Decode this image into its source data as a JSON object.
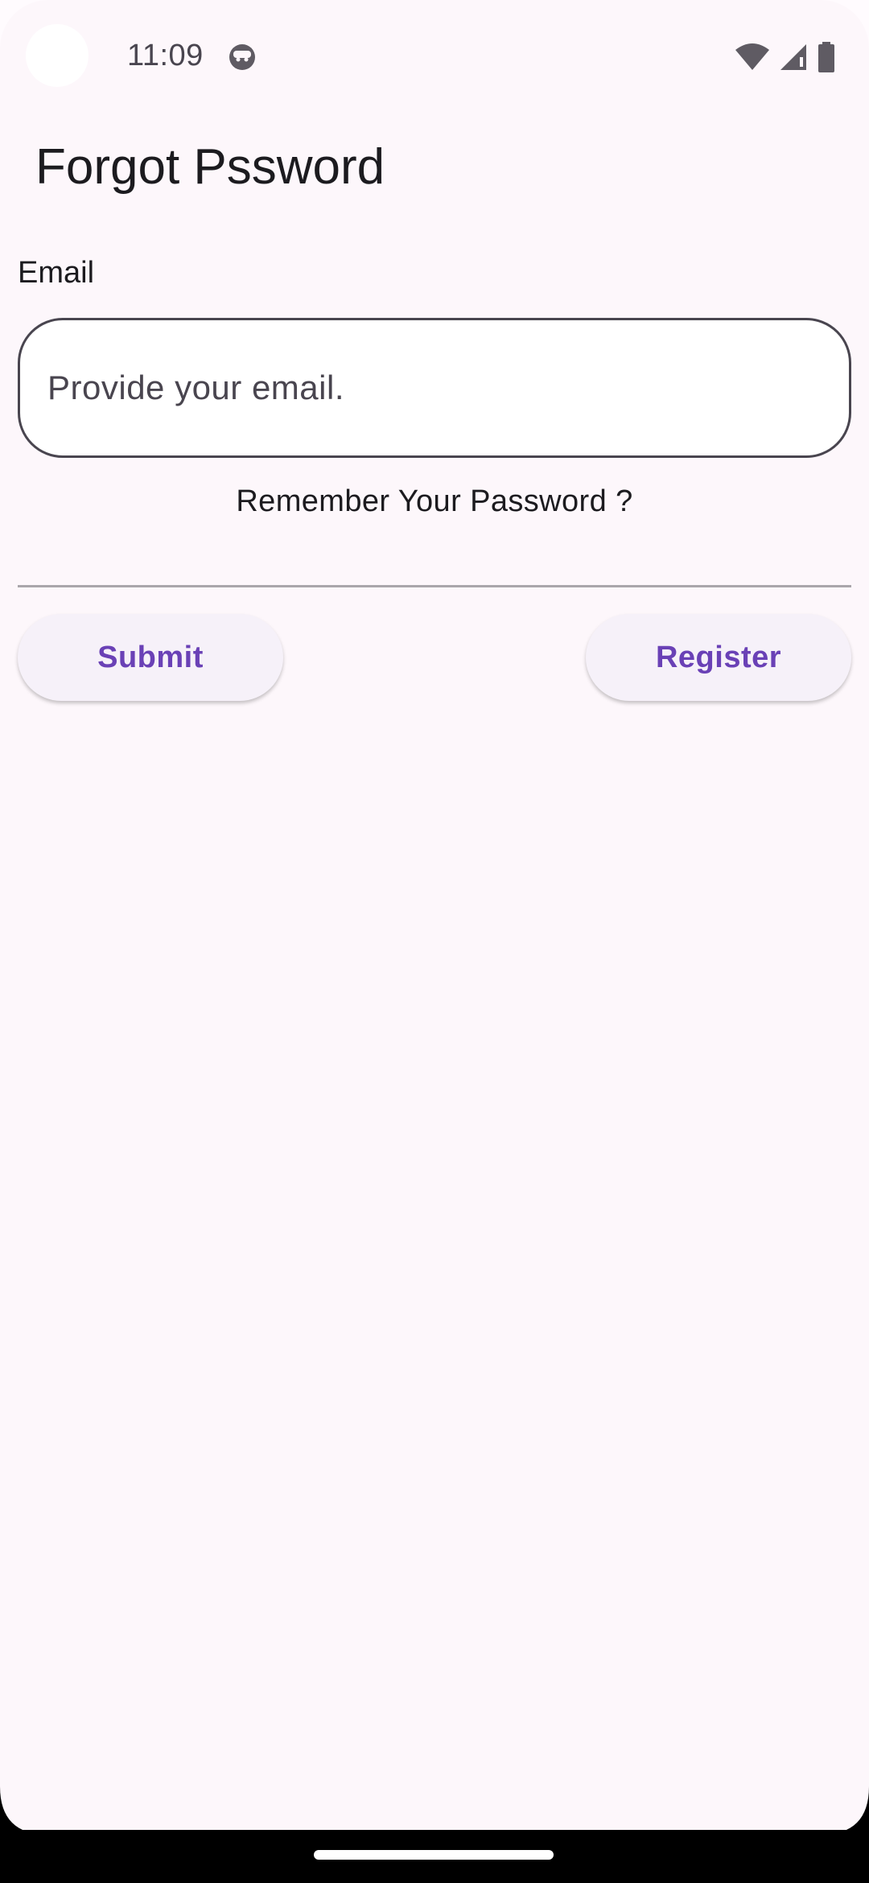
{
  "status_bar": {
    "time": "11:09",
    "icons": [
      "android-face-icon",
      "wifi-icon",
      "signal-icon",
      "battery-icon"
    ]
  },
  "title": "Forgot Pssword",
  "email": {
    "label": "Email",
    "placeholder": "Provide your email.",
    "value": ""
  },
  "remember_link": "Remember Your Password ?",
  "buttons": {
    "submit": "Submit",
    "register": "Register"
  },
  "colors": {
    "background": "#fdf7fb",
    "accent": "#6a41b6",
    "button_bg": "#f6f1f9",
    "outline": "#49454f"
  }
}
